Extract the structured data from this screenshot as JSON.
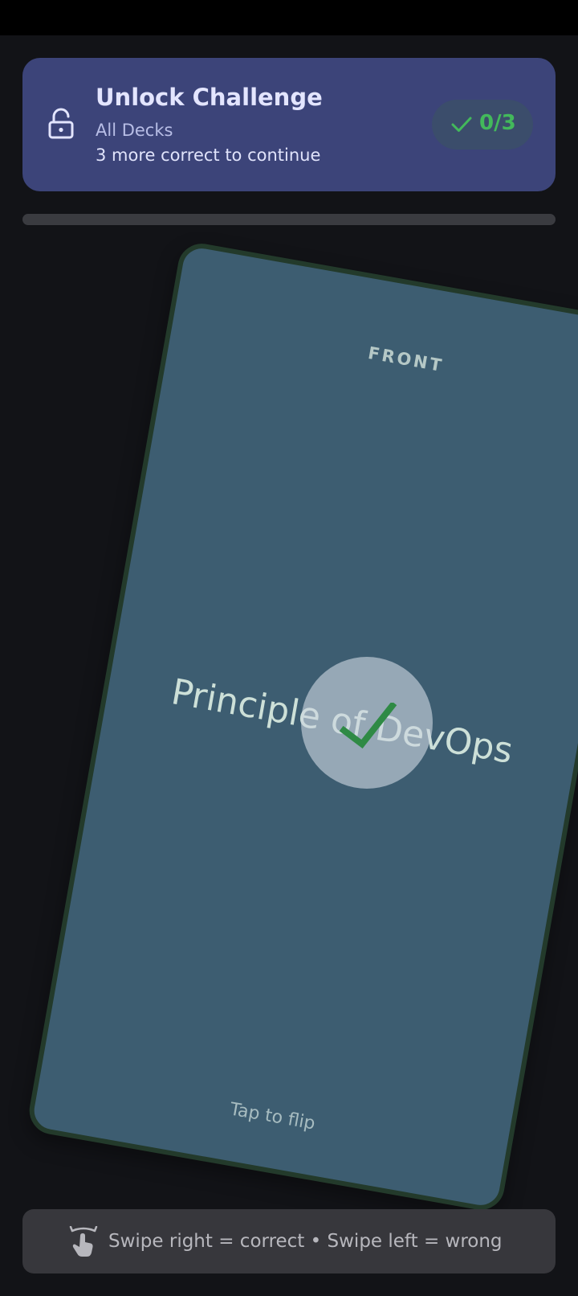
{
  "challenge": {
    "title": "Unlock Challenge",
    "deck": "All Decks",
    "remaining": "3 more correct to continue",
    "score": "0/3",
    "lock_icon": "lock-open-icon",
    "check_icon": "check-icon"
  },
  "progress": {
    "value": 0
  },
  "card": {
    "side_label": "FRONT",
    "question": "Principle of DevOps",
    "hint": "Tap to flip",
    "overlay_icon": "check-icon"
  },
  "swipe_hint": {
    "icon": "swipe-gesture-icon",
    "text": "Swipe right = correct • Swipe left = wrong"
  },
  "colors": {
    "background": "#121317",
    "challenge_card": "#3c4479",
    "score_pill": "#3b4d6b",
    "success_green": "#43b95b",
    "flash_card": "#3d5d71",
    "flash_card_border": "#233a2b"
  }
}
